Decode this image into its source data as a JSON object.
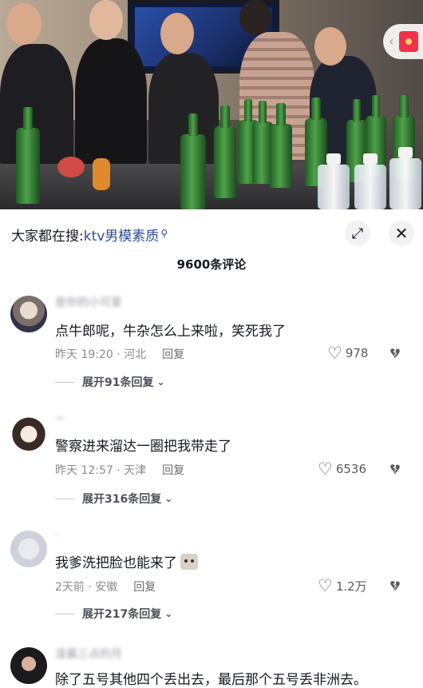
{
  "search": {
    "prefix": "大家都在搜:",
    "keyword": "ktv男模素质"
  },
  "header": {
    "comment_count": "9600条评论"
  },
  "comments": [
    {
      "username": "是你的小可爱",
      "text": "点牛郎呢，牛杂怎么上来啦，笑死我了",
      "time": "昨天 19:20 · 河北",
      "reply_label": "回复",
      "likes": "978",
      "expand_label": "展开91条回复"
    },
    {
      "username": "~",
      "text": "警察进来溜达一圈把我带走了",
      "time": "昨天 12:57 · 天津",
      "reply_label": "回复",
      "likes": "6536",
      "expand_label": "展开316条回复"
    },
    {
      "username": "·",
      "text": "我爹洗把脸也能来了",
      "time": "2天前 · 安徽",
      "reply_label": "回复",
      "likes": "1.2万",
      "expand_label": "展开217条回复"
    },
    {
      "username": "凌晨三点的月",
      "text": "除了五号其他四个丢出去，最后那个五号丢非洲去。"
    }
  ],
  "icons": {
    "search_mag": "🔍",
    "fullscreen": "⤢",
    "close": "✕",
    "heart": "♡",
    "dislike": "♥̸",
    "chevron": "⌄",
    "redpacket": "red-envelope-icon"
  },
  "colors": {
    "keyword_blue": "#2b4c9b",
    "text_primary": "#161823",
    "text_secondary": "#8a8b91",
    "red_envelope": "#f2314a"
  }
}
